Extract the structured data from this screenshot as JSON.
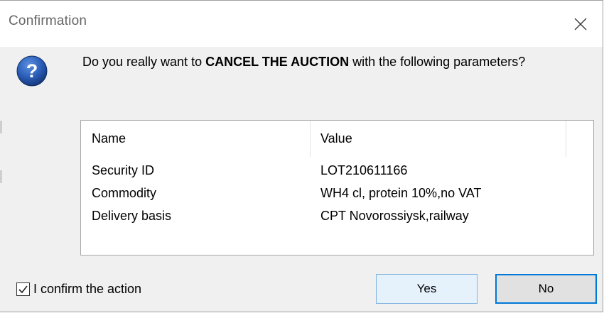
{
  "window": {
    "title": "Confirmation"
  },
  "message": {
    "prefix": "Do you really want to ",
    "emphasis": "CANCEL THE AUCTION",
    "suffix": " with the following parameters?"
  },
  "table": {
    "columns": [
      "Name",
      "Value"
    ],
    "rows": [
      {
        "name": "Security ID",
        "value": "LOT210611166"
      },
      {
        "name": "Commodity",
        "value": "WH4 cl, protein 10%,no VAT"
      },
      {
        "name": "Delivery basis",
        "value": "CPT Novorossiysk,railway"
      }
    ]
  },
  "footer": {
    "confirm_label": "I confirm the action",
    "confirm_checked": true,
    "yes_label": "Yes",
    "no_label": "No"
  },
  "icons": {
    "question": "question-icon",
    "close": "close-icon",
    "check": "check-icon"
  },
  "colors": {
    "accent": "#0078d7",
    "dialog_bg": "#f0f0f0",
    "icon_blue": "#1d4fa3"
  }
}
